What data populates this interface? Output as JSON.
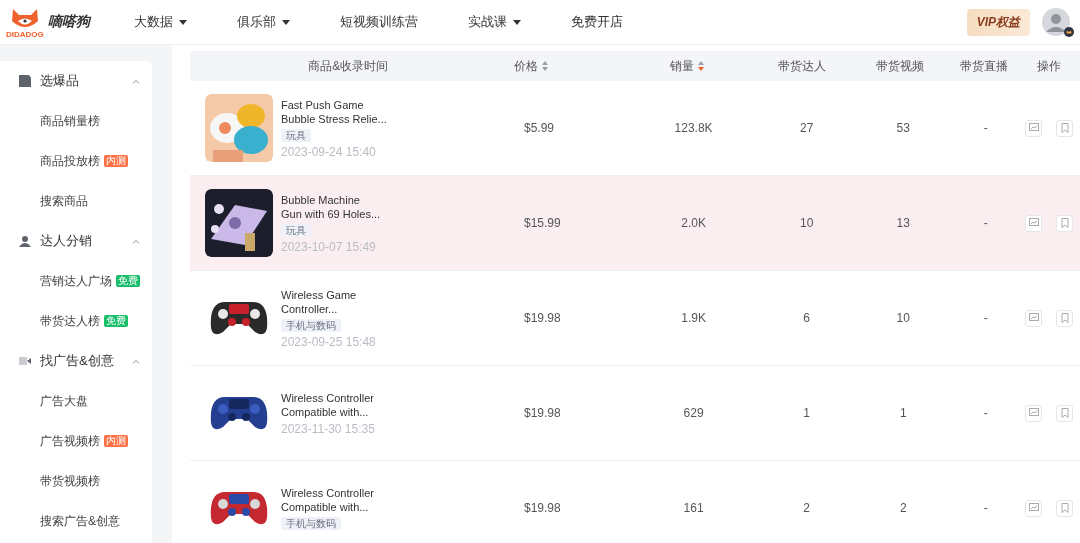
{
  "brand": {
    "name": "嘀嗒狗",
    "logo_text": "DIDADOG"
  },
  "nav": [
    {
      "label": "大数据",
      "dropdown": true
    },
    {
      "label": "俱乐部",
      "dropdown": true
    },
    {
      "label": "短视频训练营",
      "dropdown": false
    },
    {
      "label": "实战课",
      "dropdown": true
    },
    {
      "label": "免费开店",
      "dropdown": false
    }
  ],
  "vip": "VIP权益",
  "sidebar": {
    "groups": [
      {
        "label": "选爆品",
        "expanded": true,
        "items": [
          {
            "label": "商品销量榜"
          },
          {
            "label": "商品投放榜",
            "badge": {
              "text": "内测",
              "color": "#ff7043"
            }
          },
          {
            "label": "搜索商品"
          }
        ]
      },
      {
        "label": "达人分销",
        "expanded": true,
        "items": [
          {
            "label": "营销达人广场",
            "badge": {
              "text": "免费",
              "color": "#19be6b"
            }
          },
          {
            "label": "带货达人榜",
            "badge": {
              "text": "免费",
              "color": "#19be6b"
            }
          }
        ]
      },
      {
        "label": "找广告&创意",
        "expanded": true,
        "items": [
          {
            "label": "广告大盘"
          },
          {
            "label": "广告视频榜",
            "badge": {
              "text": "内测",
              "color": "#ff7043"
            }
          },
          {
            "label": "带货视频榜"
          },
          {
            "label": "搜索广告&创意"
          }
        ]
      }
    ]
  },
  "table": {
    "columns": [
      {
        "label": "商品&收录时间"
      },
      {
        "label": "价格",
        "sorted": false
      },
      {
        "label": "销量",
        "sorted": true
      },
      {
        "label": "带货达人"
      },
      {
        "label": "带货视频"
      },
      {
        "label": "带货直播"
      },
      {
        "label": "操作"
      }
    ],
    "rows": [
      {
        "title": [
          "Fast Push Game",
          "Bubble Stress Relie..."
        ],
        "tag": "玩具",
        "time": "2023-09-24 15:40",
        "price": "$5.99",
        "sales": "123.8K",
        "creators": "27",
        "videos": "53",
        "live": "-",
        "highlighted": false
      },
      {
        "title": [
          "Bubble Machine",
          "Gun with 69 Holes..."
        ],
        "tag": "玩具",
        "time": "2023-10-07 15:49",
        "price": "$15.99",
        "sales": "2.0K",
        "creators": "10",
        "videos": "13",
        "live": "-",
        "highlighted": true
      },
      {
        "title": [
          "Wireless Game",
          "Controller..."
        ],
        "tag": "手机与数码",
        "time": "2023-09-25 15:48",
        "price": "$19.98",
        "sales": "1.9K",
        "creators": "6",
        "videos": "10",
        "live": "-",
        "highlighted": false
      },
      {
        "title": [
          "Wireless Controller",
          "Compatible with..."
        ],
        "time": "2023-11-30 15:35",
        "price": "$19.98",
        "sales": "629",
        "creators": "1",
        "videos": "1",
        "live": "-",
        "highlighted": false
      },
      {
        "title": [
          "Wireless Controller",
          "Compatible with..."
        ],
        "tag": "手机与数码",
        "price": "$19.98",
        "sales": "161",
        "creators": "2",
        "videos": "2",
        "live": "-",
        "highlighted": false
      }
    ]
  }
}
